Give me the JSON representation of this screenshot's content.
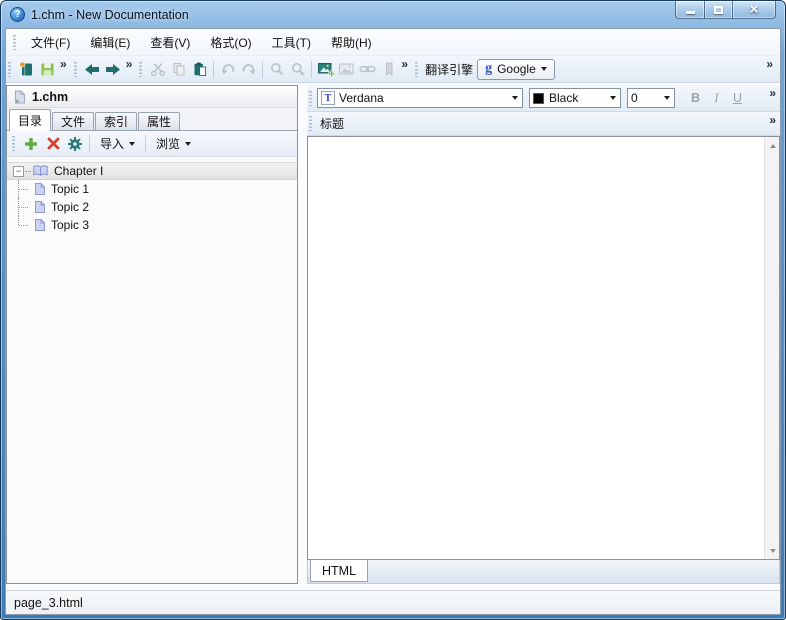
{
  "window": {
    "title": "1.chm - New Documentation",
    "help_glyph": "?",
    "close_glyph": "×"
  },
  "menu": {
    "items": [
      {
        "label": "文件(F)"
      },
      {
        "label": "编辑(E)"
      },
      {
        "label": "查看(V)"
      },
      {
        "label": "格式(O)"
      },
      {
        "label": "工具(T)"
      },
      {
        "label": "帮助(H)"
      }
    ]
  },
  "toolbar": {
    "chevron": "»",
    "translate": {
      "label": "翻译引擎",
      "icon_letter": "g",
      "engine": "Google"
    },
    "icon_names": [
      "new-book",
      "save",
      "back-arrow",
      "forward-arrow",
      "cut",
      "copy",
      "paste",
      "undo",
      "redo",
      "search",
      "search-next",
      "insert-image",
      "image",
      "link",
      "bookmark"
    ]
  },
  "left_panel": {
    "file_name": "1.chm",
    "tabs": [
      {
        "label": "目录",
        "active": true
      },
      {
        "label": "文件",
        "active": false
      },
      {
        "label": "索引",
        "active": false
      },
      {
        "label": "属性",
        "active": false
      }
    ],
    "tree_toolbar": {
      "import_label": "导入",
      "browse_label": "浏览",
      "icon_names": [
        "add",
        "delete",
        "settings"
      ]
    },
    "tree": {
      "expander_glyph": "−",
      "root_label": "Chapter I",
      "topics": [
        {
          "label": "Topic 1"
        },
        {
          "label": "Topic 2"
        },
        {
          "label": "Topic 3"
        }
      ]
    }
  },
  "editor_panel": {
    "font_toolbar": {
      "font_icon_letter": "T",
      "font_name": "Verdana",
      "color_name": "Black",
      "font_size": "0",
      "bold": "B",
      "italic": "I",
      "underline": "U",
      "chevron": "»"
    },
    "title_toolbar": {
      "label": "标题",
      "chevron": "»"
    },
    "bottom_tabs": [
      {
        "label": "HTML",
        "active": true
      }
    ]
  },
  "status_bar": {
    "text": "page_3.html"
  },
  "colors": {
    "accent_teal": "#1f6f6e",
    "disabled_icon": "#b9c1c9",
    "save_green": "#8cbf52",
    "add_green": "#5fae3a",
    "delete_red": "#d6402c",
    "titlebar_blue": "#5d96cc",
    "selection_gray": "#e8e8e8",
    "google_blue": "#3350c4",
    "tree_icon_fill": "#ccd3f0"
  }
}
